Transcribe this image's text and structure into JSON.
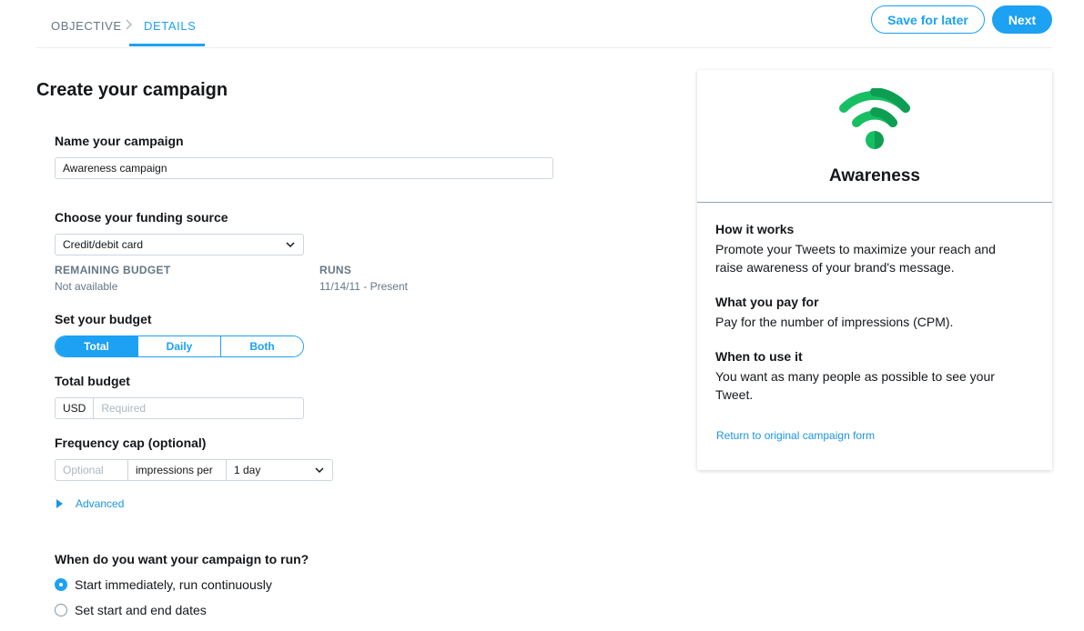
{
  "nav": {
    "step_objective": "OBJECTIVE",
    "step_details": "DETAILS",
    "save_label": "Save for later",
    "next_label": "Next"
  },
  "page_title": "Create your campaign",
  "name_section": {
    "label": "Name your campaign",
    "value": "Awareness campaign"
  },
  "funding": {
    "label": "Choose your funding source",
    "selected": "Credit/debit card",
    "remaining_budget_label": "REMAINING BUDGET",
    "remaining_budget_value": "Not available",
    "runs_label": "RUNS",
    "runs_value": "11/14/11 - Present"
  },
  "budget": {
    "label": "Set your budget",
    "options": [
      "Total",
      "Daily",
      "Both"
    ],
    "active": "Total"
  },
  "total_budget": {
    "label": "Total budget",
    "currency": "USD",
    "placeholder": "Required"
  },
  "frequency_cap": {
    "label": "Frequency cap (optional)",
    "placeholder": "Optional",
    "middle_text": "impressions per",
    "period": "1 day"
  },
  "advanced_label": "Advanced",
  "schedule": {
    "question": "When do you want your campaign to run?",
    "options": [
      "Start immediately, run continuously",
      "Set start and end dates"
    ],
    "selected_index": 0
  },
  "card": {
    "title": "Awareness",
    "icon": "wifi-signal-icon",
    "icon_colors": [
      "#17bf63",
      "#0e9e53"
    ],
    "sections": [
      {
        "heading": "How it works",
        "text": "Promote your Tweets to maximize your reach and raise awareness of your brand's message."
      },
      {
        "heading": "What you pay for",
        "text": "Pay for the number of impressions (CPM)."
      },
      {
        "heading": "When to use it",
        "text": "You want as many people as possible to see your Tweet."
      }
    ],
    "link": "Return to original campaign form"
  },
  "colors": {
    "accent": "#1da1f2",
    "link": "#1b95e0",
    "muted": "#657786"
  }
}
